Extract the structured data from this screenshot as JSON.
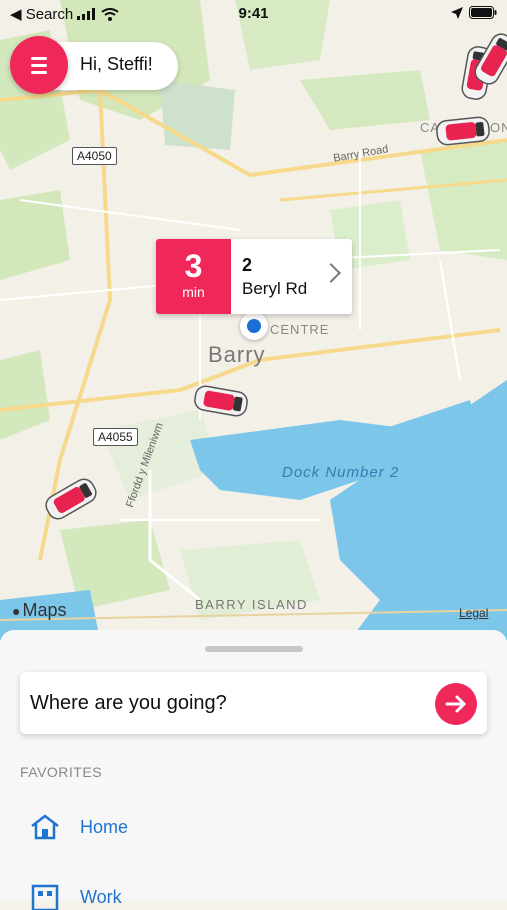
{
  "status_bar": {
    "back_label": "◀ Search",
    "time": "9:41"
  },
  "header": {
    "greeting": "Hi, Steffi!"
  },
  "map": {
    "labels": {
      "barry": "Barry",
      "barry_road": "Barry Road",
      "dock": "Dock Number 2",
      "barry_island": "BARRY ISLAND",
      "ffordd": "Ffordd y Mileniwm",
      "centre": "CENTRE",
      "cadoxton": "CA",
      "cadoxton2": "ON",
      "maps_credit": "Maps",
      "legal": "Legal"
    },
    "road_shields": [
      "A4050",
      "A4055"
    ]
  },
  "eta_card": {
    "minutes": "3",
    "unit": "min",
    "address_line1": "2",
    "address_line2": "Beryl Rd"
  },
  "panel": {
    "search_placeholder": "Where are you going?",
    "favorites_title": "FAVORITES",
    "favorites": [
      {
        "label": "Home",
        "icon": "home-icon"
      },
      {
        "label": "Work",
        "icon": "work-icon"
      }
    ]
  },
  "colors": {
    "accent": "#f0285a",
    "link": "#1f73d1",
    "water": "#7cc6ea",
    "park": "#cfe6b5"
  }
}
